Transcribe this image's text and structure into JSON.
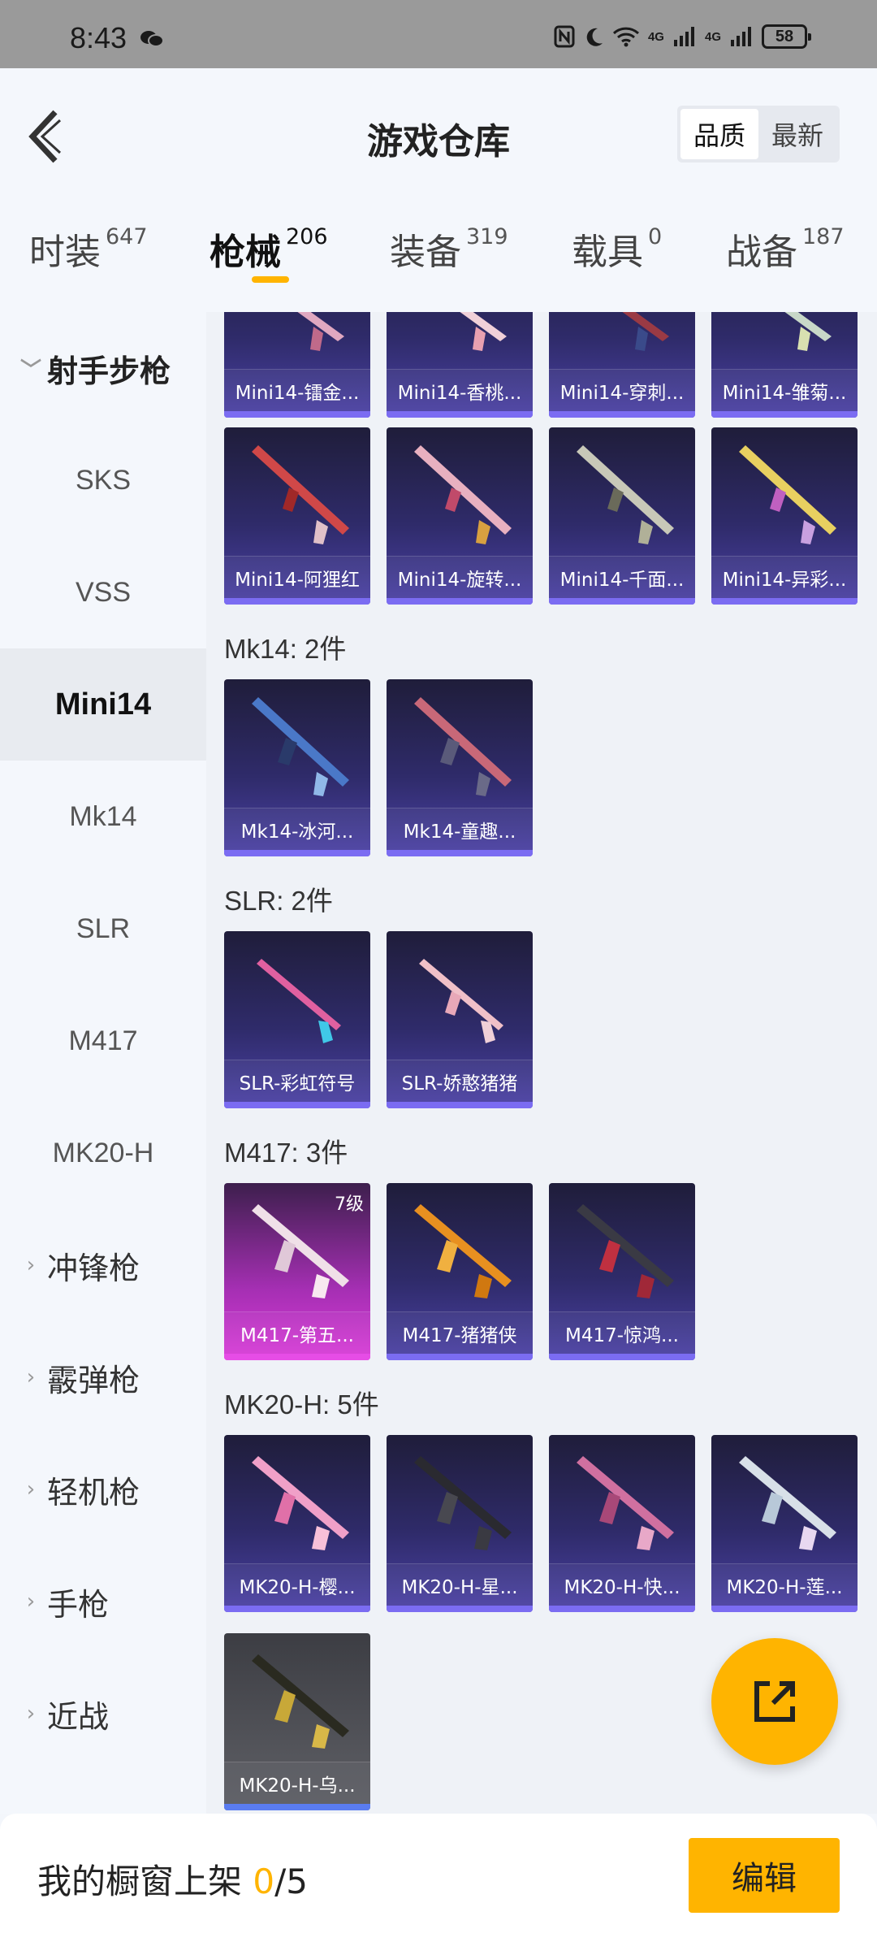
{
  "status_bar": {
    "time": "8:43",
    "battery": "58",
    "net1": "4G",
    "net2": "4G"
  },
  "header": {
    "title": "游戏仓库",
    "sort": [
      "品质",
      "最新"
    ],
    "sort_active": 0
  },
  "tabs": [
    {
      "label": "时装",
      "count": "647"
    },
    {
      "label": "枪械",
      "count": "206",
      "active": true
    },
    {
      "label": "装备",
      "count": "319"
    },
    {
      "label": "载具",
      "count": "0"
    },
    {
      "label": "战备",
      "count": "187"
    }
  ],
  "sidebar": {
    "open_category": "射手步枪",
    "sub_items": [
      "SKS",
      "VSS",
      "Mini14",
      "Mk14",
      "SLR",
      "M417",
      "MK20-H"
    ],
    "active_item": "Mini14",
    "categories": [
      "冲锋枪",
      "霰弹枪",
      "轻机枪",
      "手枪",
      "近战"
    ]
  },
  "sections": [
    {
      "label": "",
      "items": [
        {
          "name": "Mini14-镭金..."
        },
        {
          "name": "Mini14-香桃..."
        },
        {
          "name": "Mini14-穿刺..."
        },
        {
          "name": "Mini14-雏菊..."
        }
      ]
    },
    {
      "label": "",
      "items": [
        {
          "name": "Mini14-阿狸红"
        },
        {
          "name": "Mini14-旋转..."
        },
        {
          "name": "Mini14-千面..."
        },
        {
          "name": "Mini14-异彩..."
        }
      ]
    },
    {
      "label": "Mk14: 2件",
      "items": [
        {
          "name": "Mk14-冰河..."
        },
        {
          "name": "Mk14-童趣..."
        }
      ]
    },
    {
      "label": "SLR: 2件",
      "items": [
        {
          "name": "SLR-彩虹符号"
        },
        {
          "name": "SLR-娇憨猪猪"
        }
      ]
    },
    {
      "label": "M417: 3件",
      "items": [
        {
          "name": "M417-第五...",
          "badge": "7级",
          "quality": "legend"
        },
        {
          "name": "M417-猪猪侠"
        },
        {
          "name": "M417-惊鸿..."
        }
      ]
    },
    {
      "label": "MK20-H: 5件",
      "items": [
        {
          "name": "MK20-H-樱..."
        },
        {
          "name": "MK20-H-星..."
        },
        {
          "name": "MK20-H-快..."
        },
        {
          "name": "MK20-H-莲..."
        },
        {
          "name": "MK20-H-乌...",
          "quality": "grey"
        }
      ]
    }
  ],
  "footer": {
    "label": "我的橱窗上架 ",
    "current": "0",
    "total": "/5",
    "edit_label": "编辑"
  },
  "colors": {
    "accent": "#ffb400",
    "card_purple": "#4b41a5",
    "card_legend": "#d93bd8"
  }
}
